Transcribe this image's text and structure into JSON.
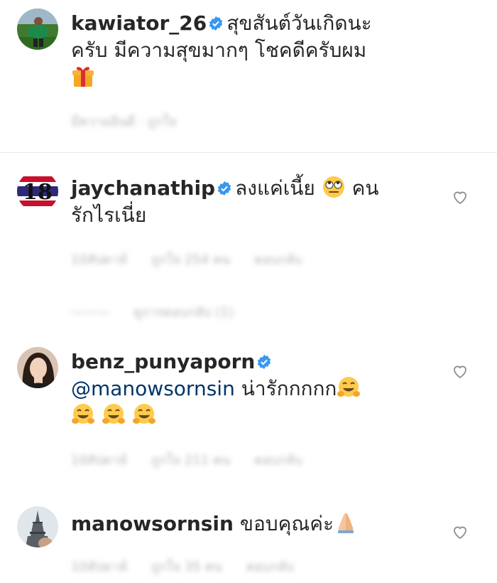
{
  "caption": {
    "username": "kawiator_26",
    "text_line1": "สุขสันต์วันเกิดนะ",
    "text_line2": "ครับ มีความสุขมากๆ โชคดีครับผม",
    "emoji": "gift-emoji",
    "meta": "มีความยินดี · ถูกใจ"
  },
  "comments": [
    {
      "username": "jaychanathip",
      "text_a": "ลงแค่เนี้ย",
      "text_b": "คน",
      "text_line2": "รักไรเนี่ย",
      "emoji": "face-with-rolling-eyes-emoji",
      "meta_time": "10สัปดาห์",
      "meta_likes": "ถูกใจ 254 คน",
      "meta_reply": "ตอบกลับ",
      "replies_toggle": "ดูการตอบกลับ (1)"
    },
    {
      "username": "benz_punyaporn",
      "mention": "@manowsornsin",
      "text": "น่ารักกกกก",
      "emoji": "hugging-face-emoji",
      "meta_time": "10สัปดาห์",
      "meta_likes": "ถูกใจ 211 คน",
      "meta_reply": "ตอบกลับ"
    },
    {
      "username": "manowsornsin",
      "text": "ขอบคุณค่ะ",
      "emoji": "folded-hands-emoji",
      "meta_time": "10สัปดาห์",
      "meta_likes": "ถูกใจ 35 คน",
      "meta_reply": "ตอบกลับ"
    }
  ],
  "colors": {
    "verified": "#3897f0",
    "mention": "#003569",
    "heart_outline": "#8e8e8e",
    "meta": "#b5b5b5"
  }
}
